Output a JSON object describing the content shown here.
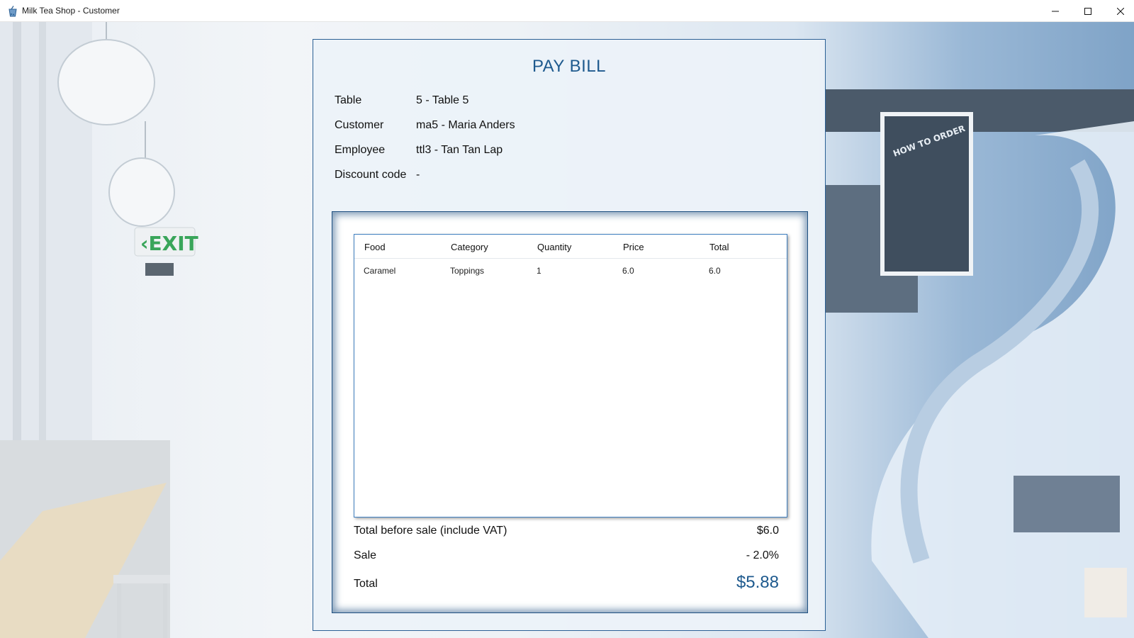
{
  "window": {
    "title": "Milk Tea Shop - Customer",
    "app_icon": "milk-tea-icon"
  },
  "background": {
    "description_icons": [
      "exit-sign",
      "pendant-lamp",
      "spiral-staircase",
      "menu-board"
    ]
  },
  "panel": {
    "title": "PAY BILL",
    "info": {
      "table_label": "Table",
      "table_value": "5 - Table 5",
      "customer_label": "Customer",
      "customer_value": "ma5 - Maria Anders",
      "employee_label": "Employee",
      "employee_value": "ttl3 - Tan Tan Lap",
      "discount_label": "Discount code",
      "discount_value": "-"
    },
    "table": {
      "columns": [
        "Food",
        "Category",
        "Quantity",
        "Price",
        "Total"
      ],
      "rows": [
        [
          "Caramel",
          "Toppings",
          "1",
          "6.0",
          "6.0"
        ]
      ]
    },
    "summary": {
      "before_label": "Total before sale (include VAT)",
      "before_value": "$6.0",
      "sale_label": "Sale",
      "sale_value": "- 2.0%",
      "total_label": "Total",
      "total_value": "$5.88"
    }
  },
  "colors": {
    "accent": "#1e5a8e",
    "panel_border": "#2b5f94",
    "table_border": "#3f7fc0"
  }
}
